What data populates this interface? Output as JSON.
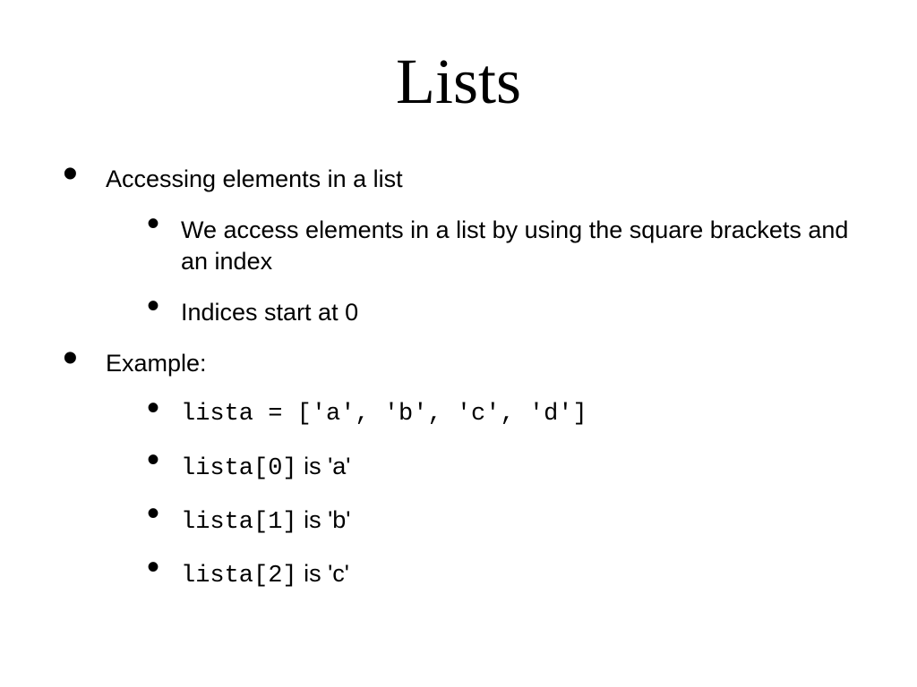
{
  "title": "Lists",
  "bullets": {
    "accessing": "Accessing elements in a list",
    "accessing_sub1": "We access elements in a list by using the square brackets and an index",
    "accessing_sub2": "Indices start at 0",
    "example": "Example:",
    "ex1_code": "lista = ['a', 'b', 'c', 'd']",
    "ex2_code": "lista[0]",
    "ex2_text": " is 'a'",
    "ex3_code": "lista[1]",
    "ex3_text": " is 'b'",
    "ex4_code": "lista[2]",
    "ex4_text": " is 'c'"
  }
}
